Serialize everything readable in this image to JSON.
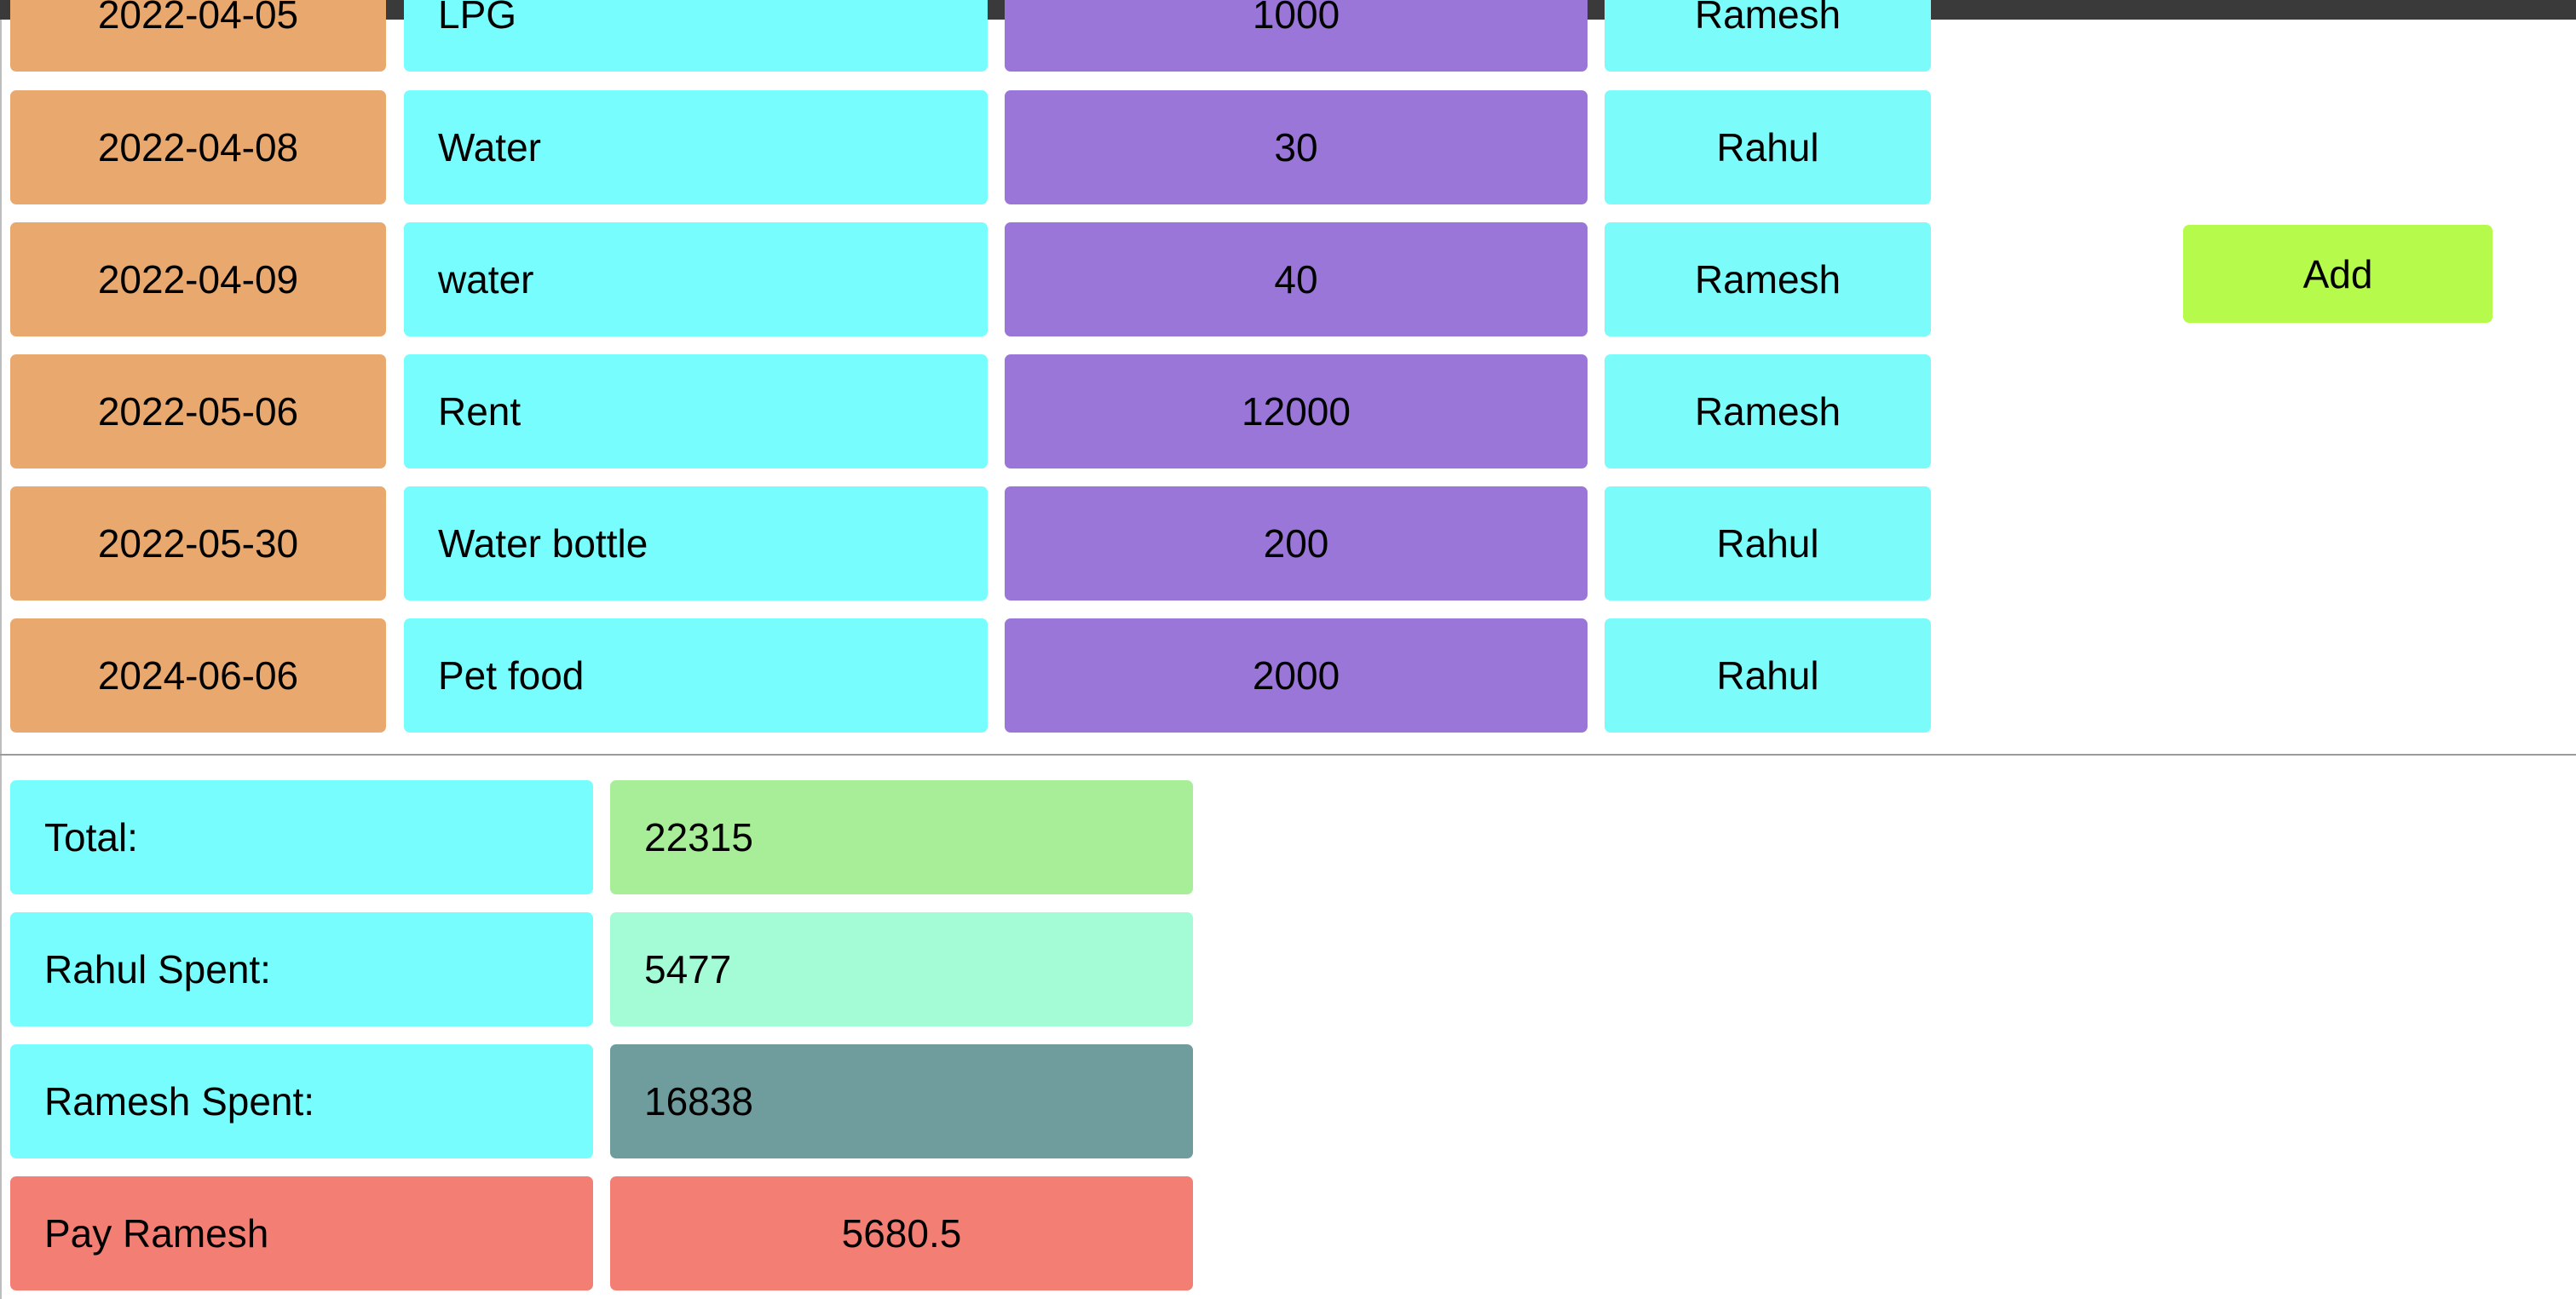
{
  "expenses": [
    {
      "date": "2022-04-05",
      "description": "LPG",
      "amount": "1000",
      "payer": "Ramesh"
    },
    {
      "date": "2022-04-08",
      "description": "Water",
      "amount": "30",
      "payer": "Rahul"
    },
    {
      "date": "2022-04-09",
      "description": "water",
      "amount": "40",
      "payer": "Ramesh"
    },
    {
      "date": "2022-05-06",
      "description": "Rent",
      "amount": "12000",
      "payer": "Ramesh"
    },
    {
      "date": "2022-05-30",
      "description": "Water bottle",
      "amount": "200",
      "payer": "Rahul"
    },
    {
      "date": "2024-06-06",
      "description": "Pet food",
      "amount": "2000",
      "payer": "Rahul"
    }
  ],
  "add_button": {
    "label": "Add"
  },
  "summary": {
    "total_label": "Total:",
    "total_value": "22315",
    "rahul_label": "Rahul Spent:",
    "rahul_value": "5477",
    "ramesh_label": "Ramesh Spent:",
    "ramesh_value": "16838",
    "pay_label": "Pay Ramesh",
    "pay_value": "5680.5"
  },
  "colors": {
    "date_cell": "#e9a96e",
    "description_cell": "#77fdfd",
    "amount_cell": "#9a76d8",
    "payer_cell": "#7cfbfb",
    "add_button": "#b6fb4b",
    "total_value": "#a8ed98",
    "rahul_value": "#a3fcd6",
    "ramesh_value": "#6f9c9d",
    "pay_row": "#f37f74"
  }
}
